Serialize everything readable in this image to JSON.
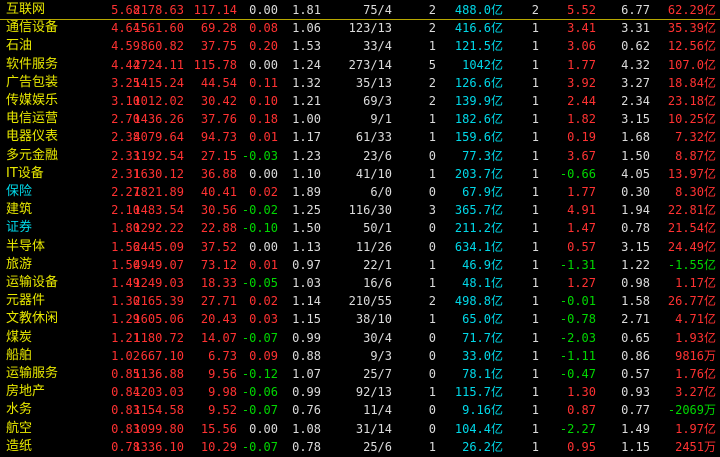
{
  "rows": [
    {
      "name": "互联网",
      "cyan": false,
      "pct": "5.68",
      "price": "2178.63",
      "chg": "117.14",
      "speed": "0.00",
      "ratio": "1.81",
      "updown": "75/4",
      "lead": "2",
      "amount": "488.0亿",
      "days": "2",
      "d3": "5.52",
      "turn": "6.77",
      "net": "62.29亿"
    },
    {
      "name": "通信设备",
      "cyan": false,
      "pct": "4.64",
      "price": "1561.60",
      "chg": "69.28",
      "speed": "0.08",
      "ratio": "1.06",
      "updown": "123/13",
      "lead": "2",
      "amount": "416.6亿",
      "days": "1",
      "d3": "3.41",
      "turn": "3.31",
      "net": "35.39亿"
    },
    {
      "name": "石油",
      "cyan": false,
      "pct": "4.59",
      "price": "860.82",
      "chg": "37.75",
      "speed": "0.20",
      "ratio": "1.53",
      "updown": "33/4",
      "lead": "1",
      "amount": "121.5亿",
      "days": "1",
      "d3": "3.06",
      "turn": "0.62",
      "net": "12.56亿"
    },
    {
      "name": "软件服务",
      "cyan": false,
      "pct": "4.44",
      "price": "2724.11",
      "chg": "115.78",
      "speed": "0.00",
      "ratio": "1.24",
      "updown": "273/14",
      "lead": "5",
      "amount": "1042亿",
      "days": "1",
      "d3": "1.77",
      "turn": "4.32",
      "net": "107.0亿"
    },
    {
      "name": "广告包装",
      "cyan": false,
      "pct": "3.25",
      "price": "1415.24",
      "chg": "44.54",
      "speed": "0.11",
      "ratio": "1.32",
      "updown": "35/13",
      "lead": "2",
      "amount": "126.6亿",
      "days": "1",
      "d3": "3.92",
      "turn": "3.27",
      "net": "18.84亿"
    },
    {
      "name": "传媒娱乐",
      "cyan": false,
      "pct": "3.10",
      "price": "1012.02",
      "chg": "30.42",
      "speed": "0.10",
      "ratio": "1.21",
      "updown": "69/3",
      "lead": "2",
      "amount": "139.9亿",
      "days": "1",
      "d3": "2.44",
      "turn": "2.34",
      "net": "23.18亿"
    },
    {
      "name": "电信运营",
      "cyan": false,
      "pct": "2.70",
      "price": "1436.26",
      "chg": "37.76",
      "speed": "0.18",
      "ratio": "1.00",
      "updown": "9/1",
      "lead": "1",
      "amount": "182.6亿",
      "days": "1",
      "d3": "1.82",
      "turn": "3.15",
      "net": "10.25亿"
    },
    {
      "name": "电器仪表",
      "cyan": false,
      "pct": "2.38",
      "price": "4079.64",
      "chg": "94.73",
      "speed": "0.01",
      "ratio": "1.17",
      "updown": "61/33",
      "lead": "1",
      "amount": "159.6亿",
      "days": "1",
      "d3": "0.19",
      "turn": "1.68",
      "net": "7.32亿"
    },
    {
      "name": "多元金融",
      "cyan": false,
      "pct": "2.33",
      "price": "1192.54",
      "chg": "27.15",
      "speed": "-0.03",
      "ratio": "1.23",
      "updown": "23/6",
      "lead": "0",
      "amount": "77.3亿",
      "days": "1",
      "d3": "3.67",
      "turn": "1.50",
      "net": "8.87亿"
    },
    {
      "name": "IT设备",
      "cyan": false,
      "pct": "2.31",
      "price": "1630.12",
      "chg": "36.88",
      "speed": "0.00",
      "ratio": "1.10",
      "updown": "41/10",
      "lead": "1",
      "amount": "203.7亿",
      "days": "1",
      "d3": "-0.66",
      "turn": "4.05",
      "net": "13.97亿"
    },
    {
      "name": "保险",
      "cyan": true,
      "pct": "2.27",
      "price": "1821.89",
      "chg": "40.41",
      "speed": "0.02",
      "ratio": "1.89",
      "updown": "6/0",
      "lead": "0",
      "amount": "67.9亿",
      "days": "1",
      "d3": "1.77",
      "turn": "0.30",
      "net": "8.30亿"
    },
    {
      "name": "建筑",
      "cyan": false,
      "pct": "2.10",
      "price": "1483.54",
      "chg": "30.56",
      "speed": "-0.02",
      "ratio": "1.25",
      "updown": "116/30",
      "lead": "3",
      "amount": "365.7亿",
      "days": "1",
      "d3": "4.91",
      "turn": "1.94",
      "net": "22.81亿"
    },
    {
      "name": "证券",
      "cyan": true,
      "pct": "1.80",
      "price": "1292.22",
      "chg": "22.88",
      "speed": "-0.10",
      "ratio": "1.50",
      "updown": "50/1",
      "lead": "0",
      "amount": "211.2亿",
      "days": "1",
      "d3": "1.47",
      "turn": "0.78",
      "net": "21.54亿"
    },
    {
      "name": "半导体",
      "cyan": false,
      "pct": "1.56",
      "price": "2445.09",
      "chg": "37.52",
      "speed": "0.00",
      "ratio": "1.13",
      "updown": "11/26",
      "lead": "0",
      "amount": "634.1亿",
      "days": "1",
      "d3": "0.57",
      "turn": "3.15",
      "net": "24.49亿"
    },
    {
      "name": "旅游",
      "cyan": false,
      "pct": "1.50",
      "price": "4949.07",
      "chg": "73.12",
      "speed": "0.01",
      "ratio": "0.97",
      "updown": "22/1",
      "lead": "1",
      "amount": "46.9亿",
      "days": "1",
      "d3": "-1.31",
      "turn": "1.22",
      "net": "-1.55亿"
    },
    {
      "name": "运输设备",
      "cyan": false,
      "pct": "1.49",
      "price": "1249.03",
      "chg": "18.33",
      "speed": "-0.05",
      "ratio": "1.03",
      "updown": "16/6",
      "lead": "1",
      "amount": "48.1亿",
      "days": "1",
      "d3": "1.27",
      "turn": "0.98",
      "net": "1.17亿"
    },
    {
      "name": "元器件",
      "cyan": false,
      "pct": "1.30",
      "price": "2165.39",
      "chg": "27.71",
      "speed": "0.02",
      "ratio": "1.14",
      "updown": "210/55",
      "lead": "2",
      "amount": "498.8亿",
      "days": "1",
      "d3": "-0.01",
      "turn": "1.58",
      "net": "26.77亿"
    },
    {
      "name": "文教休闲",
      "cyan": false,
      "pct": "1.29",
      "price": "1605.06",
      "chg": "20.43",
      "speed": "0.03",
      "ratio": "1.15",
      "updown": "38/10",
      "lead": "1",
      "amount": "65.0亿",
      "days": "1",
      "d3": "-0.78",
      "turn": "2.71",
      "net": "4.71亿"
    },
    {
      "name": "煤炭",
      "cyan": false,
      "pct": "1.21",
      "price": "1180.72",
      "chg": "14.07",
      "speed": "-0.07",
      "ratio": "0.99",
      "updown": "30/4",
      "lead": "0",
      "amount": "71.7亿",
      "days": "1",
      "d3": "-2.03",
      "turn": "0.65",
      "net": "1.93亿"
    },
    {
      "name": "船舶",
      "cyan": false,
      "pct": "1.02",
      "price": "667.10",
      "chg": "6.73",
      "speed": "0.09",
      "ratio": "0.88",
      "updown": "9/3",
      "lead": "0",
      "amount": "33.0亿",
      "days": "1",
      "d3": "-1.11",
      "turn": "0.86",
      "net": "9816万"
    },
    {
      "name": "运输服务",
      "cyan": false,
      "pct": "0.85",
      "price": "1136.88",
      "chg": "9.56",
      "speed": "-0.12",
      "ratio": "1.07",
      "updown": "25/7",
      "lead": "0",
      "amount": "78.1亿",
      "days": "1",
      "d3": "-0.47",
      "turn": "0.57",
      "net": "1.76亿"
    },
    {
      "name": "房地产",
      "cyan": false,
      "pct": "0.84",
      "price": "1203.03",
      "chg": "9.98",
      "speed": "-0.06",
      "ratio": "0.99",
      "updown": "92/13",
      "lead": "1",
      "amount": "115.7亿",
      "days": "1",
      "d3": "1.30",
      "turn": "0.93",
      "net": "3.27亿"
    },
    {
      "name": "水务",
      "cyan": false,
      "pct": "0.83",
      "price": "1154.58",
      "chg": "9.52",
      "speed": "-0.07",
      "ratio": "0.76",
      "updown": "11/4",
      "lead": "0",
      "amount": "9.16亿",
      "days": "1",
      "d3": "0.87",
      "turn": "0.77",
      "net": "-2069万"
    },
    {
      "name": "航空",
      "cyan": false,
      "pct": "0.83",
      "price": "1099.80",
      "chg": "15.56",
      "speed": "0.00",
      "ratio": "1.08",
      "updown": "31/14",
      "lead": "0",
      "amount": "104.4亿",
      "days": "1",
      "d3": "-2.27",
      "turn": "1.49",
      "net": "1.97亿"
    },
    {
      "name": "造纸",
      "cyan": false,
      "pct": "0.78",
      "price": "1336.10",
      "chg": "10.29",
      "speed": "-0.07",
      "ratio": "0.78",
      "updown": "25/6",
      "lead": "1",
      "amount": "26.2亿",
      "days": "1",
      "d3": "0.95",
      "turn": "1.15",
      "net": "2451万"
    }
  ],
  "colors": {
    "up": "#ff3232",
    "down": "#00d800",
    "neutral": "#dcdcdc",
    "name": "#e8e800",
    "amount": "#00d8e8"
  }
}
